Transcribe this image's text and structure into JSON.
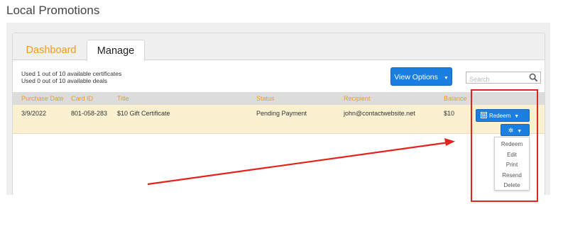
{
  "page_title": "Local Promotions",
  "tabs": [
    {
      "label": "Dashboard",
      "active": false,
      "color": "#f39a16"
    },
    {
      "label": "Manage",
      "active": true
    }
  ],
  "usage": {
    "certificates": "Used 1 out of 10 available certificates",
    "deals": "Used 0 out of 10 available deals"
  },
  "toolbar": {
    "view_options_label": "View Options",
    "view_options_caret": "▼",
    "search_placeholder": "Search"
  },
  "table": {
    "columns": [
      "Purchase Date",
      "Card ID",
      "Title",
      "Status",
      "Recipient",
      "Balance"
    ],
    "rows": [
      {
        "purchase_date": "3/9/2022",
        "card_id": "801-058-283",
        "title": "$10 Gift Certificate",
        "status": "Pending Payment",
        "recipient": "john@contactwebsite.net",
        "balance": "$10"
      }
    ]
  },
  "row_actions": {
    "redeem_label": "Redeem",
    "caret": "▼",
    "gear_glyph": "✲",
    "menu_items": [
      "Redeem",
      "Edit",
      "Print",
      "Resend",
      "Delete"
    ]
  },
  "colors": {
    "accent_orange": "#f39a16",
    "button_blue": "#1a7fe0",
    "row_highlight": "#fbf0d0",
    "annotation_red": "#e3231d"
  }
}
